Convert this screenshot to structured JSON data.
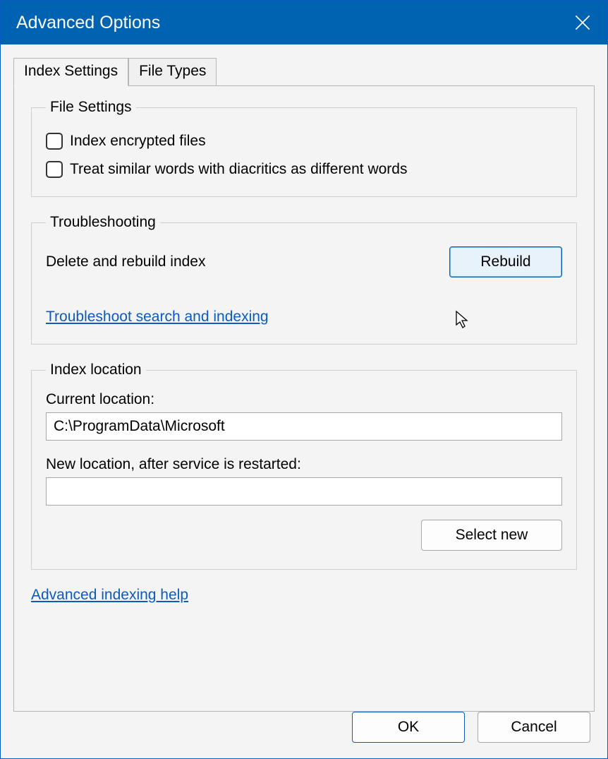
{
  "window": {
    "title": "Advanced Options"
  },
  "tabs": {
    "active": "Index Settings",
    "other": "File Types"
  },
  "file_settings": {
    "legend": "File Settings",
    "encrypt": "Index encrypted files",
    "diacritics": "Treat similar words with diacritics as different words"
  },
  "troubleshooting": {
    "legend": "Troubleshooting",
    "rebuild_label": "Delete and rebuild index",
    "rebuild_button": "Rebuild",
    "troubleshoot_link": "Troubleshoot search and indexing"
  },
  "index_location": {
    "legend": "Index location",
    "current_label": "Current location:",
    "current_value": "C:\\ProgramData\\Microsoft",
    "new_label": "New location, after service is restarted:",
    "new_value": "",
    "select_button": "Select new"
  },
  "help_link": "Advanced indexing help",
  "buttons": {
    "ok": "OK",
    "cancel": "Cancel"
  }
}
